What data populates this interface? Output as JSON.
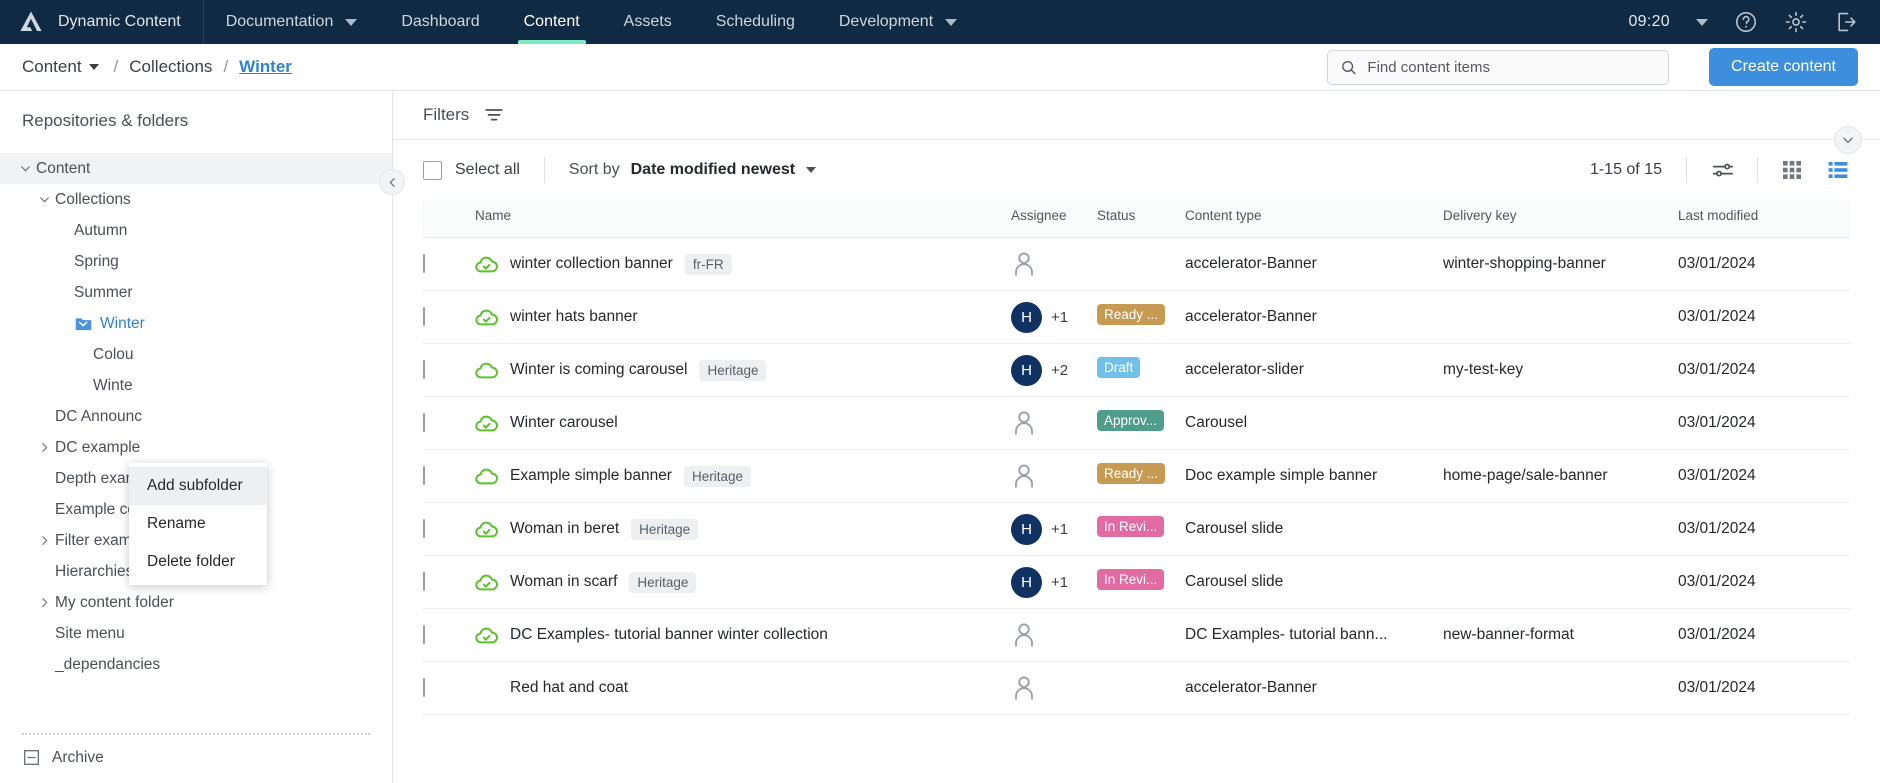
{
  "topnav": {
    "brand": "Dynamic Content",
    "items": [
      {
        "label": "Documentation",
        "caret": true,
        "active": false
      },
      {
        "label": "Dashboard",
        "caret": false,
        "active": false
      },
      {
        "label": "Content",
        "caret": false,
        "active": true
      },
      {
        "label": "Assets",
        "caret": false,
        "active": false
      },
      {
        "label": "Scheduling",
        "caret": false,
        "active": false
      },
      {
        "label": "Development",
        "caret": true,
        "active": false
      }
    ],
    "clock": "09:20",
    "icons": [
      "user-caret-icon",
      "help-icon",
      "gear-icon",
      "logout-icon"
    ],
    "accent": "#7fe9c3",
    "background": "#102a43"
  },
  "breadcrumb": {
    "root": "Content",
    "sep": "/",
    "middle": "Collections",
    "current": "Winter",
    "link_color": "#3083d4"
  },
  "search": {
    "placeholder": "Find content items",
    "value": ""
  },
  "create_button": {
    "label": "Create content",
    "color": "#3d8fdd"
  },
  "sidebar": {
    "title": "Repositories & folders",
    "tree": [
      {
        "label": "Content",
        "indent": 0,
        "chevron": "down",
        "selected": true,
        "folder": false,
        "blue": false
      },
      {
        "label": "Collections",
        "indent": 1,
        "chevron": "down",
        "selected": false,
        "folder": false,
        "blue": false
      },
      {
        "label": "Autumn",
        "indent": 2,
        "chevron": "none",
        "selected": false,
        "folder": false,
        "blue": false
      },
      {
        "label": "Spring",
        "indent": 2,
        "chevron": "none",
        "selected": false,
        "folder": false,
        "blue": false
      },
      {
        "label": "Summer",
        "indent": 2,
        "chevron": "none",
        "selected": false,
        "folder": false,
        "blue": false
      },
      {
        "label": "Winter",
        "indent": 2,
        "chevron": "none",
        "selected": false,
        "folder": true,
        "blue": true
      },
      {
        "label": "Colou",
        "indent": 3,
        "chevron": "none",
        "selected": false,
        "folder": false,
        "blue": false
      },
      {
        "label": "Winte",
        "indent": 3,
        "chevron": "none",
        "selected": false,
        "folder": false,
        "blue": false
      },
      {
        "label": "DC Announc",
        "indent": 1,
        "chevron": "none",
        "selected": false,
        "folder": false,
        "blue": false
      },
      {
        "label": "DC example",
        "indent": 1,
        "chevron": "right",
        "selected": false,
        "folder": false,
        "blue": false
      },
      {
        "label": "Depth example",
        "indent": 1,
        "chevron": "none",
        "selected": false,
        "folder": false,
        "blue": false
      },
      {
        "label": "Example content",
        "indent": 1,
        "chevron": "none",
        "selected": false,
        "folder": false,
        "blue": false
      },
      {
        "label": "Filter examples",
        "indent": 1,
        "chevron": "right",
        "selected": false,
        "folder": false,
        "blue": false
      },
      {
        "label": "Hierarchies",
        "indent": 1,
        "chevron": "none",
        "selected": false,
        "folder": false,
        "blue": false
      },
      {
        "label": "My content folder",
        "indent": 1,
        "chevron": "right",
        "selected": false,
        "folder": false,
        "blue": false
      },
      {
        "label": "Site menu",
        "indent": 1,
        "chevron": "none",
        "selected": false,
        "folder": false,
        "blue": false
      },
      {
        "label": "_dependancies",
        "indent": 1,
        "chevron": "none",
        "selected": false,
        "folder": false,
        "blue": false
      }
    ],
    "footer": {
      "label": "Archive",
      "icon": "archive-icon"
    }
  },
  "context_menu": {
    "items": [
      {
        "label": "Add subfolder",
        "hover": true
      },
      {
        "label": "Rename",
        "hover": false
      },
      {
        "label": "Delete folder",
        "hover": false
      }
    ]
  },
  "filters": {
    "label": "Filters",
    "icon": "filter-icon"
  },
  "toolbar": {
    "select_all": "Select all",
    "sort_label": "Sort by",
    "sort_value": "Date modified newest",
    "count": "1-15 of 15",
    "view_icons": [
      "settings-sliders-icon",
      "grid-view-icon",
      "list-view-icon"
    ],
    "active_view": "list-view-icon"
  },
  "table": {
    "columns": [
      "Name",
      "Assignee",
      "Status",
      "Content type",
      "Delivery key",
      "Last modified"
    ],
    "status_colors": {
      "Ready ...": "#c79a53",
      "Draft": "#70c0e7",
      "Approv...": "#4e9e8b",
      "In Revi...": "#e26ba1"
    },
    "rows": [
      {
        "name": "winter collection banner",
        "tag": "fr-FR",
        "cloud": "published",
        "avatar": "",
        "plus": "",
        "status": "",
        "type": "accelerator-Banner",
        "key": "winter-shopping-banner",
        "modified": "03/01/2024"
      },
      {
        "name": "winter hats banner",
        "tag": "",
        "cloud": "published",
        "avatar": "H",
        "plus": "+1",
        "status": "Ready ...",
        "type": "accelerator-Banner",
        "key": "",
        "modified": "03/01/2024"
      },
      {
        "name": "Winter is coming carousel",
        "tag": "Heritage",
        "cloud": "unpublished",
        "avatar": "H",
        "plus": "+2",
        "status": "Draft",
        "type": "accelerator-slider",
        "key": "my-test-key",
        "modified": "03/01/2024"
      },
      {
        "name": "Winter carousel",
        "tag": "",
        "cloud": "published",
        "avatar": "",
        "plus": "",
        "status": "Approv...",
        "type": "Carousel",
        "key": "",
        "modified": "03/01/2024"
      },
      {
        "name": "Example simple banner",
        "tag": "Heritage",
        "cloud": "unpublished",
        "avatar": "",
        "plus": "",
        "status": "Ready ...",
        "type": "Doc example simple banner",
        "key": "home-page/sale-banner",
        "modified": "03/01/2024"
      },
      {
        "name": "Woman in beret",
        "tag": "Heritage",
        "cloud": "published",
        "avatar": "H",
        "plus": "+1",
        "status": "In Revi...",
        "type": "Carousel slide",
        "key": "",
        "modified": "03/01/2024"
      },
      {
        "name": "Woman in scarf",
        "tag": "Heritage",
        "cloud": "published",
        "avatar": "H",
        "plus": "+1",
        "status": "In Revi...",
        "type": "Carousel slide",
        "key": "",
        "modified": "03/01/2024"
      },
      {
        "name": "DC Examples- tutorial banner winter collection",
        "tag": "",
        "cloud": "published",
        "avatar": "",
        "plus": "",
        "status": "",
        "type": "DC Examples- tutorial bann...",
        "key": "new-banner-format",
        "modified": "03/01/2024"
      },
      {
        "name": "Red hat and coat",
        "tag": "",
        "cloud": "none",
        "avatar": "",
        "plus": "",
        "status": "",
        "type": "accelerator-Banner",
        "key": "",
        "modified": "03/01/2024"
      }
    ]
  }
}
